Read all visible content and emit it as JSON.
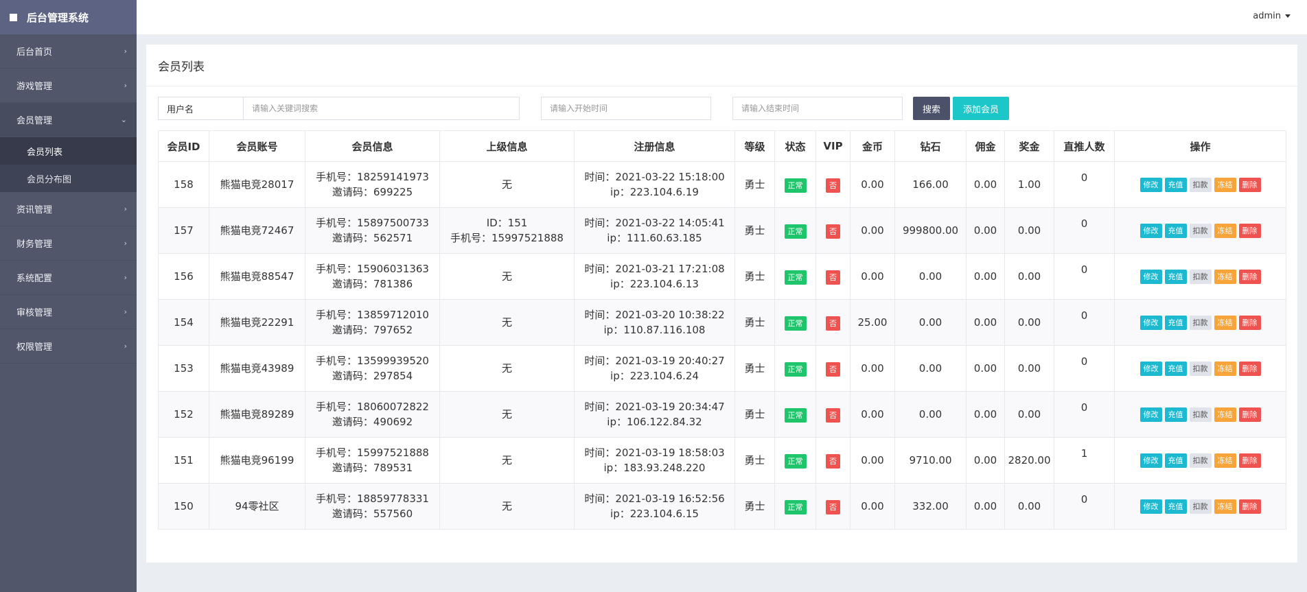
{
  "brand": {
    "title": "后台管理系统"
  },
  "sidebar": {
    "items": [
      {
        "label": "后台首页"
      },
      {
        "label": "游戏管理"
      },
      {
        "label": "会员管理",
        "children": [
          {
            "label": "会员列表"
          },
          {
            "label": "会员分布图"
          }
        ]
      },
      {
        "label": "资讯管理"
      },
      {
        "label": "财务管理"
      },
      {
        "label": "系统配置"
      },
      {
        "label": "审核管理"
      },
      {
        "label": "权限管理"
      }
    ]
  },
  "header": {
    "user": "admin"
  },
  "page": {
    "title": "会员列表"
  },
  "search": {
    "field_label": "用户名",
    "keyword_placeholder": "请输入关键词搜索",
    "start_placeholder": "请输入开始时间",
    "end_placeholder": "请输入结束时间",
    "search_label": "搜索",
    "add_label": "添加会员"
  },
  "table": {
    "columns": [
      "会员ID",
      "会员账号",
      "会员信息",
      "上级信息",
      "注册信息",
      "等级",
      "状态",
      "VIP",
      "金币",
      "钻石",
      "佣金",
      "奖金",
      "直推人数",
      "操作"
    ],
    "actions": {
      "edit": "修改",
      "charge": "充值",
      "deduct": "扣款",
      "freeze": "冻结",
      "delete": "删除"
    },
    "rows": [
      {
        "id": "158",
        "account": "熊猫电竞28017",
        "phone": "手机号：18259141973",
        "invite": "邀请码：699225",
        "parent1": "无",
        "parent2": "",
        "time": "时间：2021-03-22 15:18:00",
        "ip": "ip：223.104.6.19",
        "level": "勇士",
        "status": "正常",
        "vip": "否",
        "gold": "0.00",
        "diamond": "166.00",
        "commission": "0.00",
        "bonus": "1.00",
        "direct": "0"
      },
      {
        "id": "157",
        "account": "熊猫电竞72467",
        "phone": "手机号：15897500733",
        "invite": "邀请码：562571",
        "parent1": "ID：151",
        "parent2": "手机号：15997521888",
        "time": "时间：2021-03-22 14:05:41",
        "ip": "ip：111.60.63.185",
        "level": "勇士",
        "status": "正常",
        "vip": "否",
        "gold": "0.00",
        "diamond": "999800.00",
        "commission": "0.00",
        "bonus": "0.00",
        "direct": "0"
      },
      {
        "id": "156",
        "account": "熊猫电竞88547",
        "phone": "手机号：15906031363",
        "invite": "邀请码：781386",
        "parent1": "无",
        "parent2": "",
        "time": "时间：2021-03-21 17:21:08",
        "ip": "ip：223.104.6.13",
        "level": "勇士",
        "status": "正常",
        "vip": "否",
        "gold": "0.00",
        "diamond": "0.00",
        "commission": "0.00",
        "bonus": "0.00",
        "direct": "0"
      },
      {
        "id": "154",
        "account": "熊猫电竞22291",
        "phone": "手机号：13859712010",
        "invite": "邀请码：797652",
        "parent1": "无",
        "parent2": "",
        "time": "时间：2021-03-20 10:38:22",
        "ip": "ip：110.87.116.108",
        "level": "勇士",
        "status": "正常",
        "vip": "否",
        "gold": "25.00",
        "diamond": "0.00",
        "commission": "0.00",
        "bonus": "0.00",
        "direct": "0"
      },
      {
        "id": "153",
        "account": "熊猫电竞43989",
        "phone": "手机号：13599939520",
        "invite": "邀请码：297854",
        "parent1": "无",
        "parent2": "",
        "time": "时间：2021-03-19 20:40:27",
        "ip": "ip：223.104.6.24",
        "level": "勇士",
        "status": "正常",
        "vip": "否",
        "gold": "0.00",
        "diamond": "0.00",
        "commission": "0.00",
        "bonus": "0.00",
        "direct": "0"
      },
      {
        "id": "152",
        "account": "熊猫电竞89289",
        "phone": "手机号：18060072822",
        "invite": "邀请码：490692",
        "parent1": "无",
        "parent2": "",
        "time": "时间：2021-03-19 20:34:47",
        "ip": "ip：106.122.84.32",
        "level": "勇士",
        "status": "正常",
        "vip": "否",
        "gold": "0.00",
        "diamond": "0.00",
        "commission": "0.00",
        "bonus": "0.00",
        "direct": "0"
      },
      {
        "id": "151",
        "account": "熊猫电竞96199",
        "phone": "手机号：15997521888",
        "invite": "邀请码：789531",
        "parent1": "无",
        "parent2": "",
        "time": "时间：2021-03-19 18:58:03",
        "ip": "ip：183.93.248.220",
        "level": "勇士",
        "status": "正常",
        "vip": "否",
        "gold": "0.00",
        "diamond": "9710.00",
        "commission": "0.00",
        "bonus": "2820.00",
        "direct": "1"
      },
      {
        "id": "150",
        "account": "94零社区",
        "phone": "手机号：18859778331",
        "invite": "邀请码：557560",
        "parent1": "无",
        "parent2": "",
        "time": "时间：2021-03-19 16:52:56",
        "ip": "ip：223.104.6.15",
        "level": "勇士",
        "status": "正常",
        "vip": "否",
        "gold": "0.00",
        "diamond": "332.00",
        "commission": "0.00",
        "bonus": "0.00",
        "direct": "0"
      }
    ]
  }
}
